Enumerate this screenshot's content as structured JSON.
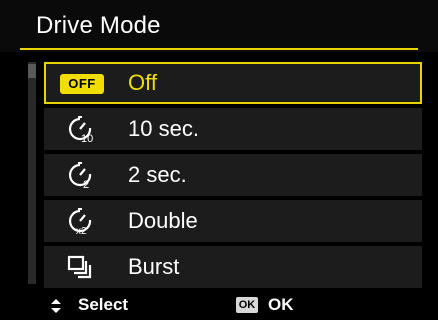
{
  "header": {
    "title": "Drive Mode"
  },
  "menu": {
    "items": [
      {
        "label": "Off",
        "icon": "off-badge-icon",
        "badge": "OFF",
        "selected": true
      },
      {
        "label": "10 sec.",
        "icon": "self-timer-10-icon",
        "selected": false
      },
      {
        "label": "2 sec.",
        "icon": "self-timer-2-icon",
        "selected": false
      },
      {
        "label": "Double",
        "icon": "self-timer-double-icon",
        "selected": false
      },
      {
        "label": "Burst",
        "icon": "burst-icon",
        "selected": false
      }
    ]
  },
  "footer": {
    "select_label": "Select",
    "ok_badge": "OK",
    "ok_label": "OK"
  },
  "colors": {
    "accent": "#e8d400",
    "background": "#000000",
    "item_background": "#1c1c1c"
  }
}
